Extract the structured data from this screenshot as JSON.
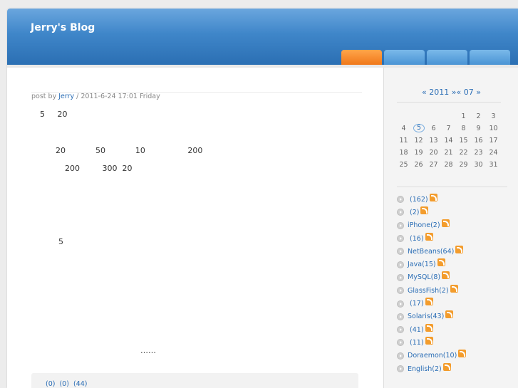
{
  "header": {
    "title": "Jerry's Blog",
    "tabs": [
      "",
      "",
      "",
      ""
    ]
  },
  "post": {
    "meta_prefix": "post by ",
    "author": "Jerry",
    "meta_suffix": " / 2011-6-24 17:01 Friday",
    "lines": [
      "5     20",
      "20            50            10                 200",
      "200         300  20",
      "5",
      "……"
    ],
    "footer_links": [
      "(0)",
      "(0)",
      "(44)"
    ]
  },
  "calendar": {
    "header": "« 2011 »« 07 »",
    "weeks": [
      [
        "",
        "",
        "",
        "",
        "1",
        "2",
        "3"
      ],
      [
        "4",
        "5",
        "6",
        "7",
        "8",
        "9",
        "10"
      ],
      [
        "11",
        "12",
        "13",
        "14",
        "15",
        "16",
        "17"
      ],
      [
        "18",
        "19",
        "20",
        "21",
        "22",
        "23",
        "24"
      ],
      [
        "25",
        "26",
        "27",
        "28",
        "29",
        "30",
        "31"
      ]
    ],
    "today": "5"
  },
  "categories": [
    " (162)",
    " (2)",
    "iPhone(2)",
    " (16)",
    "NetBeans(64)",
    "Java(15)",
    "MySQL(8)",
    "GlassFish(2)",
    " (17)",
    "Solaris(43)",
    " (41)",
    " (11)",
    "Doraemon(10)",
    "English(2)"
  ],
  "colors": {
    "header_blue": "#3f86c9",
    "tab_active": "#f0781a",
    "link": "#2a6db5"
  }
}
